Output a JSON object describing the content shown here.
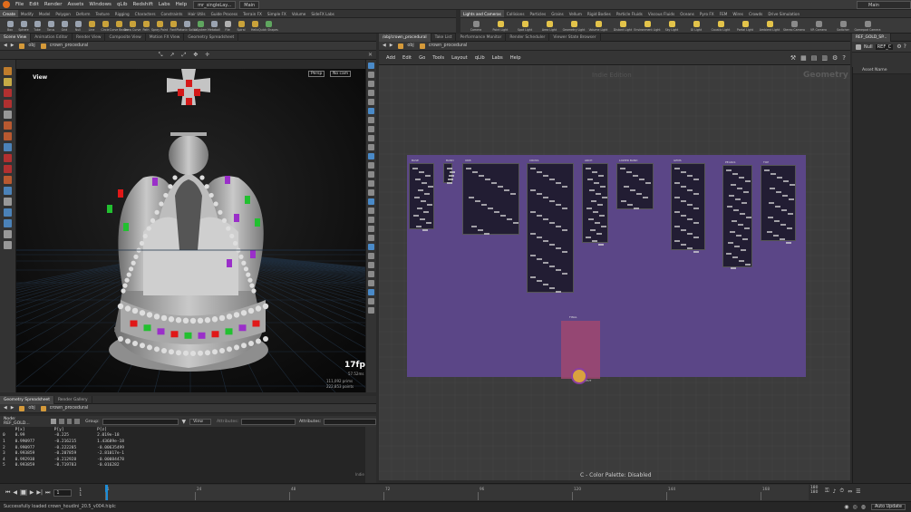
{
  "menubar": {
    "items": [
      "File",
      "Edit",
      "Render",
      "Assets",
      "Windows",
      "qLib",
      "Redshift",
      "Labs",
      "Help"
    ],
    "tabs": [
      "mr_singleLay...",
      "Main"
    ],
    "right_title": "Main"
  },
  "shelf_tabs_left": [
    "Create",
    "Modify",
    "Model",
    "Polygon",
    "Deform",
    "Texture",
    "Rigging",
    "Characters",
    "Constraints",
    "Hair Utils",
    "Guide Process",
    "Terrain FX",
    "Simple FX",
    "Volume",
    "SideFX Labs"
  ],
  "shelf_tabs_right": [
    "Lights and Cameras",
    "Collisions",
    "Particles",
    "Grains",
    "Vellum",
    "Rigid Bodies",
    "Particle Fluids",
    "Viscous Fluids",
    "Oceans",
    "Pyro FX",
    "FEM",
    "Wires",
    "Crowds",
    "Drive Simulation"
  ],
  "tools_left": [
    {
      "label": "Box",
      "color": "#9aa3b0"
    },
    {
      "label": "Sphere",
      "color": "#9aa3b0"
    },
    {
      "label": "Tube",
      "color": "#9aa3b0"
    },
    {
      "label": "Torus",
      "color": "#9aa3b0"
    },
    {
      "label": "Grid",
      "color": "#9aa3b0"
    },
    {
      "label": "Null",
      "color": "#9aa3b0"
    },
    {
      "label": "Line",
      "color": "#c9a23a"
    },
    {
      "label": "Circle",
      "color": "#c9a23a"
    },
    {
      "label": "Curve Bezier",
      "color": "#c9a23a"
    },
    {
      "label": "Draw Curve",
      "color": "#c9a23a"
    },
    {
      "label": "Path",
      "color": "#c9a23a"
    },
    {
      "label": "Spray Paint",
      "color": "#c9a23a"
    },
    {
      "label": "Font",
      "color": "#c9a23a"
    },
    {
      "label": "Platonic Solids",
      "color": "#9aa3b0"
    },
    {
      "label": "L-System",
      "color": "#5fa65f"
    },
    {
      "label": "Metaball",
      "color": "#9aa3b0"
    },
    {
      "label": "File",
      "color": "#b0b0b0"
    },
    {
      "label": "Spiral",
      "color": "#c9a23a"
    },
    {
      "label": "Helix",
      "color": "#c9a23a"
    },
    {
      "label": "Quick Shapes",
      "color": "#5fa65f"
    }
  ],
  "tools_right": [
    {
      "label": "Camera",
      "color": "#8a8a8a"
    },
    {
      "label": "Point Light",
      "color": "#e3c34a"
    },
    {
      "label": "Spot Light",
      "color": "#e3c34a"
    },
    {
      "label": "Area Light",
      "color": "#e3c34a"
    },
    {
      "label": "Geometry Light",
      "color": "#e3c34a"
    },
    {
      "label": "Volume Light",
      "color": "#e3c34a"
    },
    {
      "label": "Distant Light",
      "color": "#e3c34a"
    },
    {
      "label": "Environment Light",
      "color": "#e3c34a"
    },
    {
      "label": "Sky Light",
      "color": "#e3c34a"
    },
    {
      "label": "GI Light",
      "color": "#e3c34a"
    },
    {
      "label": "Caustic Light",
      "color": "#e3c34a"
    },
    {
      "label": "Portal Light",
      "color": "#e3c34a"
    },
    {
      "label": "Ambient Light",
      "color": "#e3c34a"
    },
    {
      "label": "Stereo Camera",
      "color": "#8a8a8a"
    },
    {
      "label": "VR Camera",
      "color": "#8a8a8a"
    },
    {
      "label": "Switcher",
      "color": "#8a8a8a"
    },
    {
      "label": "Gamepad Camera",
      "color": "#8a8a8a"
    }
  ],
  "left_pane": {
    "tabs": [
      "Scene View",
      "Animation Editor",
      "Render View",
      "Composite View",
      "Motion FX View",
      "Geometry Spreadsheet"
    ],
    "path": [
      "obj",
      "crown_procedural"
    ],
    "view_label": "View",
    "persp": "Persp",
    "cam": "No cam",
    "fps": "17fps",
    "ms": "57.52ms",
    "prims": "111,092  prims",
    "points": "222,853 points"
  },
  "sheet_pane": {
    "tabs": [
      "Geometry Spreadsheet",
      "Render Gallery"
    ],
    "path": [
      "obj",
      "crown_procedural"
    ],
    "node": "Node: REF_GOLD...",
    "group_label": "Group:",
    "view_label": "View",
    "attributes_label": "Attributes:",
    "columns": [
      "",
      "P[x]",
      "P[y]",
      "P[z]"
    ],
    "rows": [
      [
        "0",
        "0.99",
        "-0.225",
        "2.019e-18"
      ],
      [
        "1",
        "0.990977",
        "-0.216215",
        "1.43689e-18"
      ],
      [
        "2",
        "0.990977",
        "-0.222285",
        "-0.00635499"
      ],
      [
        "3",
        "0.993859",
        "-0.207859",
        "-2.81017e-1"
      ],
      [
        "4",
        "0.992938",
        "-0.212928",
        "-0.00084478"
      ],
      [
        "5",
        "0.993859",
        "-0.719783",
        "-0.016282"
      ]
    ],
    "indie": "Indie"
  },
  "right_pane": {
    "tabs": [
      "/obj/crown_procedural",
      "Take List",
      "Performance Monitor",
      "Render Scheduler",
      "Viewer State Browser"
    ],
    "path": [
      "obj",
      "crown_procedural"
    ],
    "menu": [
      "Add",
      "Edit",
      "Go",
      "Tools",
      "Layout",
      "qLib",
      "Labs",
      "Help"
    ],
    "watermark": "Indie Edition",
    "context": "Geometry",
    "color_palette": "C - Color Palette: Disabled",
    "network_titles": [
      "BASE",
      "BAND",
      "ORB",
      "CROSS",
      "ARCH",
      "LOWER BAND",
      "GEMS",
      "PEARLS",
      "TOP",
      "FINAL",
      "OUTPUT"
    ]
  },
  "params_pane": {
    "tab": "REF_GOLD_SP...",
    "node_type": "Null",
    "node_name": "REF_C",
    "asset_name_label": "Asset Name"
  },
  "timeline": {
    "frame": "1",
    "start": "1",
    "end": "1",
    "ticks": [
      "1",
      "24",
      "48",
      "72",
      "96",
      "120",
      "144",
      "168"
    ],
    "range_end": "180",
    "range_end2": "180"
  },
  "status": {
    "message": "Successfully loaded crown_houdini_20.5_v004.hiplc",
    "auto_update": "Auto Update"
  },
  "colors": {
    "network_bg": "#5b4687",
    "node_box": "#221d33",
    "accent": "#e8a13c",
    "gem_red": "#e01818",
    "gem_green": "#22c030",
    "gem_purple": "#9a2fc9"
  }
}
